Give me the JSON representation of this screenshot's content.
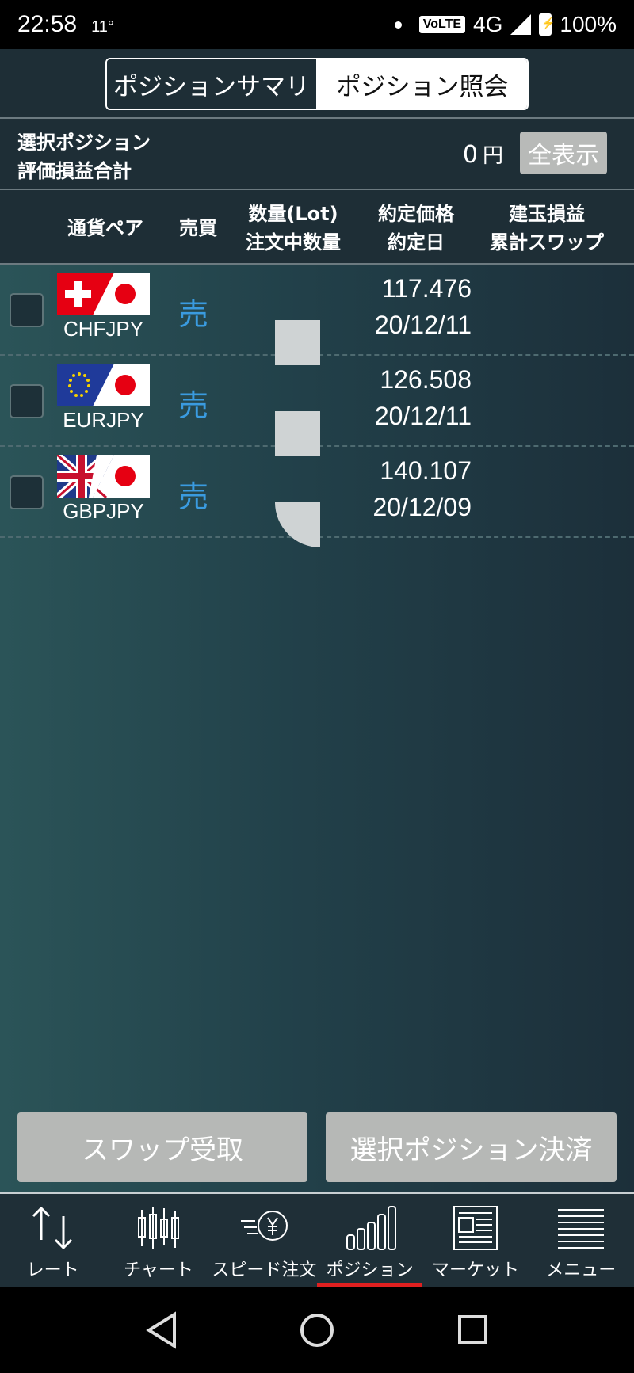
{
  "status": {
    "time": "22:58",
    "temp": "11°",
    "volte": "VoLTE",
    "network": "4G",
    "battery": "100%"
  },
  "tabs": {
    "summary": "ポジションサマリ",
    "inquiry": "ポジション照会"
  },
  "summary": {
    "label_line1": "選択ポジション",
    "label_line2": "評価損益合計",
    "value": "0",
    "unit": "円",
    "show_all": "全表示"
  },
  "columns": {
    "pair": "通貨ペア",
    "side": "売買",
    "qty_line1": "数量(Lot)",
    "qty_line2": "注文中数量",
    "price_line1": "約定価格",
    "price_line2": "約定日",
    "pl_line1": "建玉損益",
    "pl_line2": "累計スワップ"
  },
  "positions": [
    {
      "pair": "CHFJPY",
      "side": "売",
      "price": "117.476",
      "date": "20/12/11"
    },
    {
      "pair": "EURJPY",
      "side": "売",
      "price": "126.508",
      "date": "20/12/11"
    },
    {
      "pair": "GBPJPY",
      "side": "売",
      "price": "140.107",
      "date": "20/12/09"
    }
  ],
  "actions": {
    "swap_receive": "スワップ受取",
    "settle_selected": "選択ポジション決済"
  },
  "nav": [
    {
      "label": "レート",
      "icon": "rate-arrows-icon"
    },
    {
      "label": "チャート",
      "icon": "candlestick-icon"
    },
    {
      "label": "スピード注文",
      "icon": "speed-order-yen-icon"
    },
    {
      "label": "ポジション",
      "icon": "bar-chart-icon",
      "active": true
    },
    {
      "label": "マーケット",
      "icon": "newspaper-icon"
    },
    {
      "label": "メニュー",
      "icon": "menu-lines-icon"
    }
  ],
  "colors": {
    "accent_red": "#e02020",
    "sell_blue": "#3a9be0"
  }
}
